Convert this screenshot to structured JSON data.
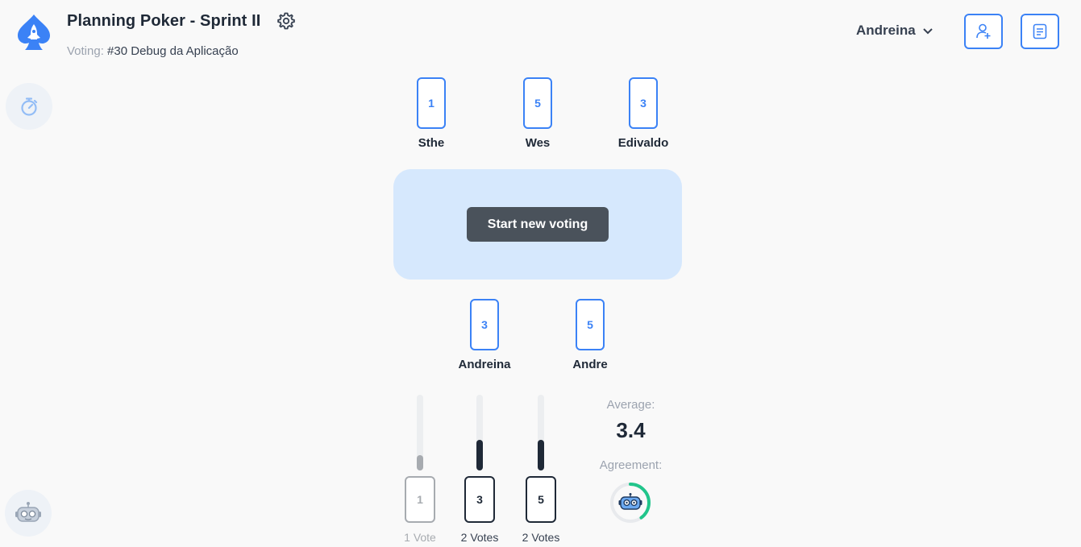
{
  "header": {
    "title": "Planning Poker - Sprint II",
    "voting_label": "Voting:",
    "voting_issue": "#30 Debug da Aplicação",
    "user_name": "Andreina"
  },
  "players_top": [
    {
      "name": "Sthe",
      "card": "1"
    },
    {
      "name": "Wes",
      "card": "5"
    },
    {
      "name": "Edivaldo",
      "card": "3"
    }
  ],
  "players_bottom": [
    {
      "name": "Andreina",
      "card": "3"
    },
    {
      "name": "Andre",
      "card": "5"
    }
  ],
  "table": {
    "start_button_label": "Start new voting"
  },
  "results": {
    "cards": [
      {
        "value": "1",
        "votes_label": "1 Vote",
        "votes": 1
      },
      {
        "value": "3",
        "votes_label": "2 Votes",
        "votes": 2
      },
      {
        "value": "5",
        "votes_label": "2 Votes",
        "votes": 2
      }
    ],
    "max_votes": 5,
    "average_label": "Average:",
    "average_value": "3.4",
    "agreement_label": "Agreement:",
    "agreement_fraction": 0.4
  },
  "colors": {
    "accent": "#3b82f6",
    "table": "#d6e8fd",
    "button_dark": "#4a525b",
    "agreement": "#22c58b"
  },
  "icons": [
    "spade-rocket-logo-icon",
    "gear-icon",
    "chevron-down-icon",
    "add-user-icon",
    "document-list-icon",
    "timer-icon",
    "robot-icon"
  ]
}
